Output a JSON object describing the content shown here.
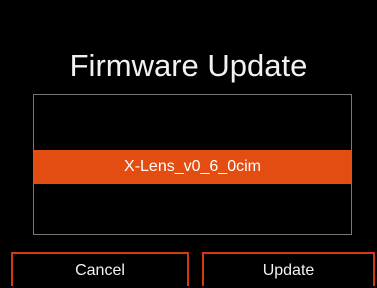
{
  "dialog": {
    "title": "Firmware Update"
  },
  "file_list": {
    "items": [
      {
        "label": "X-Lens_v0_6_0cim",
        "selected": true
      }
    ]
  },
  "buttons": {
    "cancel_label": "Cancel",
    "update_label": "Update"
  },
  "colors": {
    "accent": "#e44d12",
    "button_border": "#d63a0c",
    "background": "#000000"
  }
}
